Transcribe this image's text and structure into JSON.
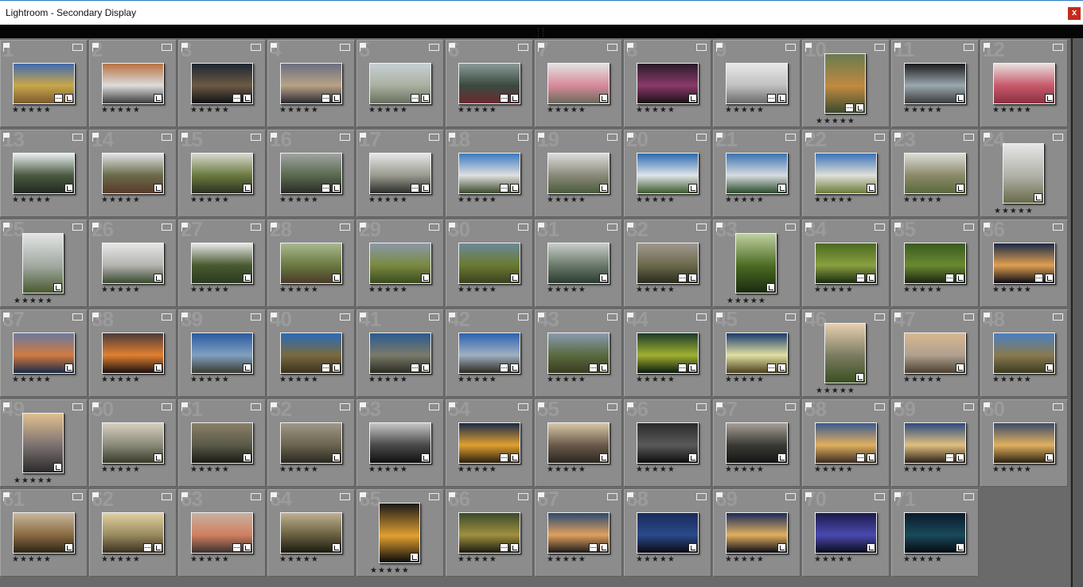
{
  "window": {
    "title": "Lightroom - Secondary Display",
    "close_label": "x"
  },
  "colors": {
    "accent": "#2b78c2",
    "close": "#c42b1c",
    "cell": "#8c8c8c",
    "background": "#6a6a6a"
  },
  "grid": {
    "columns": 12,
    "rating_text": "★★★★★",
    "cells": [
      {
        "num": "1",
        "orient": "l",
        "badges": 2,
        "c": [
          "#3f6bb0",
          "#c9a74a",
          "#7a5a30"
        ]
      },
      {
        "num": "2",
        "orient": "l",
        "badges": 1,
        "c": [
          "#b87142",
          "#dcdcdc",
          "#3b3b3b"
        ]
      },
      {
        "num": "3",
        "orient": "l",
        "badges": 2,
        "c": [
          "#1c2733",
          "#6c5a44",
          "#0e1115"
        ]
      },
      {
        "num": "4",
        "orient": "l",
        "badges": 2,
        "c": [
          "#6b6f80",
          "#b8a286",
          "#2a2a30"
        ]
      },
      {
        "num": "5",
        "orient": "l",
        "badges": 2,
        "c": [
          "#c8cfd5",
          "#aab0a0",
          "#6a7060"
        ]
      },
      {
        "num": "6",
        "orient": "l",
        "badges": 2,
        "c": [
          "#8a9a98",
          "#3a4a40",
          "#6b2a30"
        ]
      },
      {
        "num": "7",
        "orient": "l",
        "badges": 1,
        "c": [
          "#e2e2e2",
          "#d88a9a",
          "#6a6a5a"
        ]
      },
      {
        "num": "8",
        "orient": "l",
        "badges": 1,
        "c": [
          "#2a1a2a",
          "#8a3a6a",
          "#1a1014"
        ]
      },
      {
        "num": "9",
        "orient": "l",
        "badges": 2,
        "c": [
          "#e8e8e8",
          "#c0c0c0",
          "#6a6a6a"
        ]
      },
      {
        "num": "10",
        "orient": "p",
        "badges": 2,
        "c": [
          "#6a7a50",
          "#c08a40",
          "#3a4a30"
        ]
      },
      {
        "num": "11",
        "orient": "l",
        "badges": 1,
        "c": [
          "#1a1a1a",
          "#9aa8b0",
          "#3a3a3a"
        ]
      },
      {
        "num": "12",
        "orient": "l",
        "badges": 1,
        "c": [
          "#e8e0e0",
          "#c85a6a",
          "#8a3040"
        ]
      },
      {
        "num": "13",
        "orient": "l",
        "badges": 1,
        "c": [
          "#e8eef0",
          "#4a5a40",
          "#202820"
        ]
      },
      {
        "num": "14",
        "orient": "l",
        "badges": 1,
        "c": [
          "#e0e4e6",
          "#6a6a4a",
          "#5a3a2a"
        ]
      },
      {
        "num": "15",
        "orient": "l",
        "badges": 1,
        "c": [
          "#d8d8d0",
          "#6a7a40",
          "#2a3020"
        ]
      },
      {
        "num": "16",
        "orient": "l",
        "badges": 2,
        "c": [
          "#a0a4a0",
          "#5a6a50",
          "#2a2a24"
        ]
      },
      {
        "num": "17",
        "orient": "l",
        "badges": 2,
        "c": [
          "#e6e6e6",
          "#9a9a90",
          "#2a2e28"
        ]
      },
      {
        "num": "18",
        "orient": "l",
        "badges": 2,
        "c": [
          "#3a7ac0",
          "#e0e0e0",
          "#3a4a2a"
        ]
      },
      {
        "num": "19",
        "orient": "l",
        "badges": 1,
        "c": [
          "#dcdcdc",
          "#8a8a7a",
          "#4a5a3a"
        ]
      },
      {
        "num": "20",
        "orient": "l",
        "badges": 1,
        "c": [
          "#2a6ab0",
          "#e0e4e8",
          "#3a5a2a"
        ]
      },
      {
        "num": "21",
        "orient": "l",
        "badges": 1,
        "c": [
          "#3a72b0",
          "#d8dce0",
          "#2a4a2a"
        ]
      },
      {
        "num": "22",
        "orient": "l",
        "badges": 1,
        "c": [
          "#3a72b8",
          "#e0e0d8",
          "#6a7a3a"
        ]
      },
      {
        "num": "23",
        "orient": "l",
        "badges": 1,
        "c": [
          "#dcdcd8",
          "#8a8a6a",
          "#5a6a3a"
        ]
      },
      {
        "num": "24",
        "orient": "p",
        "badges": 1,
        "c": [
          "#e6e6e6",
          "#b0b0a8",
          "#6a6a4a"
        ]
      },
      {
        "num": "25",
        "orient": "p",
        "badges": 1,
        "c": [
          "#e2e4e4",
          "#a0a8a0",
          "#4a5a30"
        ]
      },
      {
        "num": "26",
        "orient": "l",
        "badges": 1,
        "c": [
          "#e6e6e6",
          "#b4b4b0",
          "#3a4a30"
        ]
      },
      {
        "num": "27",
        "orient": "l",
        "badges": 1,
        "c": [
          "#e8e8e8",
          "#4a5a30",
          "#2a3a20"
        ]
      },
      {
        "num": "28",
        "orient": "l",
        "badges": 1,
        "c": [
          "#a8b890",
          "#6a7a40",
          "#4a3a2a"
        ]
      },
      {
        "num": "29",
        "orient": "l",
        "badges": 1,
        "c": [
          "#8a98a8",
          "#7a8a40",
          "#3a4a20"
        ]
      },
      {
        "num": "30",
        "orient": "l",
        "badges": 1,
        "c": [
          "#6a8a98",
          "#6a7a30",
          "#3a4020"
        ]
      },
      {
        "num": "31",
        "orient": "l",
        "badges": 1,
        "c": [
          "#c8cccc",
          "#6a7a6a",
          "#2a3a30"
        ]
      },
      {
        "num": "32",
        "orient": "l",
        "badges": 2,
        "c": [
          "#a09890",
          "#6a6a4a",
          "#2a2a20"
        ]
      },
      {
        "num": "33",
        "orient": "p",
        "badges": 1,
        "c": [
          "#c0d0a0",
          "#4a6a20",
          "#1a2a10"
        ]
      },
      {
        "num": "34",
        "orient": "l",
        "badges": 2,
        "c": [
          "#4a6a20",
          "#8aa040",
          "#1a2a10"
        ]
      },
      {
        "num": "35",
        "orient": "l",
        "badges": 2,
        "c": [
          "#3a5a20",
          "#6a8a30",
          "#1a2410"
        ]
      },
      {
        "num": "36",
        "orient": "l",
        "badges": 2,
        "c": [
          "#1a2a4a",
          "#e0a050",
          "#0a0a14"
        ]
      },
      {
        "num": "37",
        "orient": "l",
        "badges": 1,
        "c": [
          "#6a7aa0",
          "#d07a40",
          "#1a2a4a"
        ]
      },
      {
        "num": "38",
        "orient": "l",
        "badges": 1,
        "c": [
          "#4a3a3a",
          "#e08030",
          "#1a1010"
        ]
      },
      {
        "num": "39",
        "orient": "l",
        "badges": 1,
        "c": [
          "#2a5aa0",
          "#80a0c0",
          "#3a3a30"
        ]
      },
      {
        "num": "40",
        "orient": "l",
        "badges": 2,
        "c": [
          "#2a6ab8",
          "#7a6a40",
          "#3a3020"
        ]
      },
      {
        "num": "41",
        "orient": "l",
        "badges": 2,
        "c": [
          "#2a5a90",
          "#7a7a6a",
          "#2a2a20"
        ]
      },
      {
        "num": "42",
        "orient": "l",
        "badges": 2,
        "c": [
          "#2a62b0",
          "#a0b0c0",
          "#2a2a20"
        ]
      },
      {
        "num": "43",
        "orient": "l",
        "badges": 2,
        "c": [
          "#8a9ab0",
          "#5a6a40",
          "#3a3a20"
        ]
      },
      {
        "num": "44",
        "orient": "l",
        "badges": 2,
        "c": [
          "#1a3a2a",
          "#a0b030",
          "#0a1a10"
        ]
      },
      {
        "num": "45",
        "orient": "l",
        "badges": 2,
        "c": [
          "#1a3a70",
          "#e0e0a0",
          "#4a4020"
        ]
      },
      {
        "num": "46",
        "orient": "p",
        "badges": 1,
        "c": [
          "#e6d0b0",
          "#7a7a60",
          "#3a5020"
        ]
      },
      {
        "num": "47",
        "orient": "l",
        "badges": 1,
        "c": [
          "#d8b890",
          "#b0a090",
          "#4a4030"
        ]
      },
      {
        "num": "48",
        "orient": "l",
        "badges": 1,
        "c": [
          "#4a80c0",
          "#8a7a50",
          "#3a3a20"
        ]
      },
      {
        "num": "49",
        "orient": "p",
        "badges": 1,
        "c": [
          "#e0c090",
          "#7a7070",
          "#2a2a28"
        ]
      },
      {
        "num": "50",
        "orient": "l",
        "badges": 1,
        "c": [
          "#d8d0c0",
          "#8a8a7a",
          "#3a3a2a"
        ]
      },
      {
        "num": "51",
        "orient": "l",
        "badges": 1,
        "c": [
          "#8a8068",
          "#5a5a48",
          "#1a1a14"
        ]
      },
      {
        "num": "52",
        "orient": "l",
        "badges": 1,
        "c": [
          "#a09888",
          "#6a6450",
          "#2a2820"
        ]
      },
      {
        "num": "53",
        "orient": "l",
        "badges": 1,
        "c": [
          "#c8c8c8",
          "#4a4a4a",
          "#101010"
        ]
      },
      {
        "num": "54",
        "orient": "l",
        "badges": 2,
        "c": [
          "#1a2a4a",
          "#e0a030",
          "#2a2010"
        ]
      },
      {
        "num": "55",
        "orient": "l",
        "badges": 1,
        "c": [
          "#d8c8a8",
          "#6a5a4a",
          "#2a2620"
        ]
      },
      {
        "num": "56",
        "orient": "l",
        "badges": 1,
        "c": [
          "#2a2a2a",
          "#5a5a5a",
          "#0e0e0e"
        ]
      },
      {
        "num": "57",
        "orient": "l",
        "badges": 1,
        "c": [
          "#a8a098",
          "#3a3a34",
          "#141414"
        ]
      },
      {
        "num": "58",
        "orient": "l",
        "badges": 2,
        "c": [
          "#3a5a90",
          "#e0b060",
          "#3a2a20"
        ]
      },
      {
        "num": "59",
        "orient": "l",
        "badges": 2,
        "c": [
          "#2a4a80",
          "#e0c080",
          "#2a2018"
        ]
      },
      {
        "num": "60",
        "orient": "l",
        "badges": 1,
        "c": [
          "#3a4a6a",
          "#e0b060",
          "#2a2010"
        ]
      },
      {
        "num": "61",
        "orient": "l",
        "badges": 1,
        "c": [
          "#c8b8a0",
          "#8a6a40",
          "#2a2418"
        ]
      },
      {
        "num": "62",
        "orient": "l",
        "badges": 2,
        "c": [
          "#e0d0a0",
          "#9a8a60",
          "#3a3020"
        ]
      },
      {
        "num": "63",
        "orient": "l",
        "badges": 2,
        "c": [
          "#c8b0a0",
          "#d08060",
          "#3a3030"
        ]
      },
      {
        "num": "64",
        "orient": "l",
        "badges": 1,
        "c": [
          "#c0b090",
          "#6a6040",
          "#1a1a10"
        ]
      },
      {
        "num": "65",
        "orient": "p",
        "badges": 1,
        "c": [
          "#1a1a1a",
          "#e0a030",
          "#0a0a0a"
        ]
      },
      {
        "num": "66",
        "orient": "l",
        "badges": 2,
        "c": [
          "#3a4a2a",
          "#a09040",
          "#1a1a10"
        ]
      },
      {
        "num": "67",
        "orient": "l",
        "badges": 2,
        "c": [
          "#2a4a70",
          "#e0a060",
          "#1a1a18"
        ]
      },
      {
        "num": "68",
        "orient": "l",
        "badges": 1,
        "c": [
          "#1a2a5a",
          "#2a4a8a",
          "#0a0a14"
        ]
      },
      {
        "num": "69",
        "orient": "l",
        "badges": 1,
        "c": [
          "#1a2a5a",
          "#e0b060",
          "#0a0a14"
        ]
      },
      {
        "num": "70",
        "orient": "l",
        "badges": 1,
        "c": [
          "#1a1a4a",
          "#4a4ab0",
          "#0a0a1a"
        ]
      },
      {
        "num": "71",
        "orient": "l",
        "badges": 1,
        "c": [
          "#0a1a2a",
          "#1a4a5a",
          "#060a10"
        ]
      }
    ]
  }
}
